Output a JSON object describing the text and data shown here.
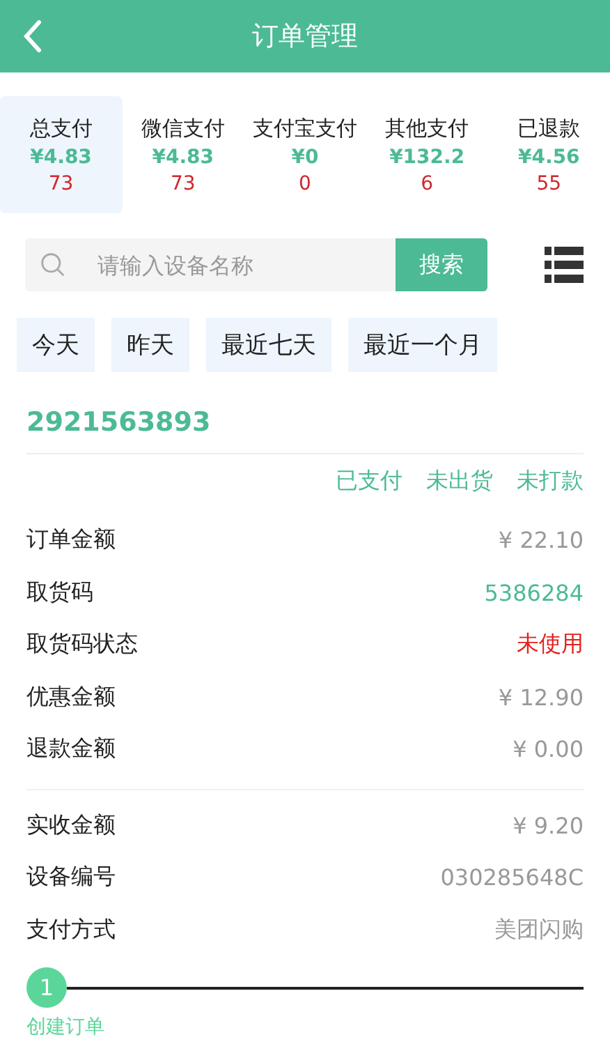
{
  "header": {
    "title": "订单管理"
  },
  "stats": [
    {
      "label": "总支付",
      "amount": "¥4.83",
      "count": "73",
      "selected": true
    },
    {
      "label": "微信支付",
      "amount": "¥4.83",
      "count": "73",
      "selected": false
    },
    {
      "label": "支付宝支付",
      "amount": "¥0",
      "count": "0",
      "selected": false
    },
    {
      "label": "其他支付",
      "amount": "¥132.2",
      "count": "6",
      "selected": false
    },
    {
      "label": "已退款",
      "amount": "¥4.56",
      "count": "55",
      "selected": false
    }
  ],
  "search": {
    "placeholder": "请输入设备名称",
    "button": "搜索"
  },
  "date_filters": [
    "今天",
    "昨天",
    "最近七天",
    "最近一个月"
  ],
  "order": {
    "number": "2921563893",
    "statuses": [
      "已支付",
      "未出货",
      "未打款"
    ],
    "groups": [
      [
        {
          "label": "订单金额",
          "value": "¥ 22.10",
          "kind": "plain"
        },
        {
          "label": "取货码",
          "value": "5386284",
          "kind": "accent"
        },
        {
          "label": "取货码状态",
          "value": "未使用",
          "kind": "alert"
        },
        {
          "label": "优惠金额",
          "value": "¥ 12.90",
          "kind": "plain"
        },
        {
          "label": "退款金额",
          "value": "¥ 0.00",
          "kind": "plain"
        }
      ],
      [
        {
          "label": "实收金额",
          "value": "¥ 9.20",
          "kind": "plain"
        },
        {
          "label": "设备编号",
          "value": "030285648C",
          "kind": "plain"
        },
        {
          "label": "支付方式",
          "value": "美团闪购",
          "kind": "plain"
        }
      ]
    ],
    "steps": [
      {
        "number": "1",
        "label": "创建订单"
      }
    ]
  }
}
